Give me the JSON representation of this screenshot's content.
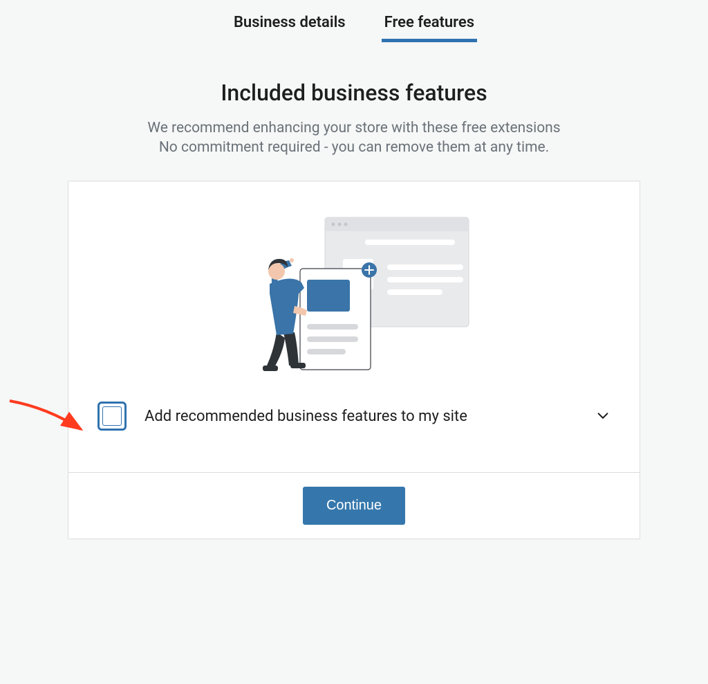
{
  "tabs": {
    "business_details": "Business details",
    "free_features": "Free features"
  },
  "title": "Included business features",
  "subtitle1": "We recommend enhancing your store with these free extensions",
  "subtitle2": "No commitment required - you can remove them at any time.",
  "option": {
    "label": "Add recommended business features to my site"
  },
  "actions": {
    "continue": "Continue"
  }
}
